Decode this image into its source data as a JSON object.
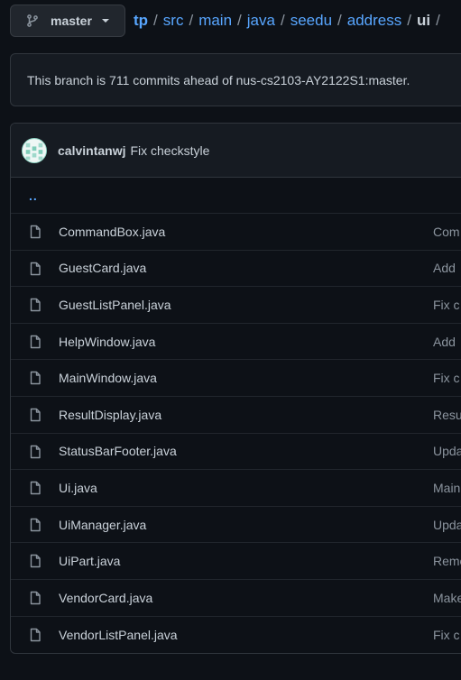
{
  "branch": {
    "name": "master"
  },
  "breadcrumb": {
    "root": "tp",
    "parts": [
      "src",
      "main",
      "java",
      "seedu",
      "address"
    ],
    "current": "ui",
    "separator": "/"
  },
  "ahead_notice": "This branch is 711 commits ahead of nus-cs2103-AY2122S1:master.",
  "latest_commit": {
    "author": "calvintanwj",
    "message": "Fix checkstyle"
  },
  "parent_link": "..",
  "files": [
    {
      "name": "CommandBox.java",
      "message": "Com"
    },
    {
      "name": "GuestCard.java",
      "message": "Add"
    },
    {
      "name": "GuestListPanel.java",
      "message": "Fix c"
    },
    {
      "name": "HelpWindow.java",
      "message": "Add"
    },
    {
      "name": "MainWindow.java",
      "message": "Fix c"
    },
    {
      "name": "ResultDisplay.java",
      "message": "Resu"
    },
    {
      "name": "StatusBarFooter.java",
      "message": "Upda"
    },
    {
      "name": "Ui.java",
      "message": "Main"
    },
    {
      "name": "UiManager.java",
      "message": "Upda"
    },
    {
      "name": "UiPart.java",
      "message": "Remo"
    },
    {
      "name": "VendorCard.java",
      "message": "Make"
    },
    {
      "name": "VendorListPanel.java",
      "message": "Fix c"
    }
  ],
  "colors": {
    "background": "#0d1117",
    "link": "#58a6ff",
    "text": "#c9d1d9",
    "muted": "#8b949e",
    "border": "#30363d"
  }
}
